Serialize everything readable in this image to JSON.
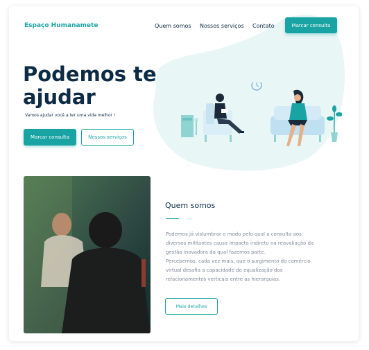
{
  "nav": {
    "brand": "Espaço Humanamete",
    "links": [
      "Quem somos",
      "Nossos serviços",
      "Contato"
    ],
    "cta": "Marcar consulta"
  },
  "hero": {
    "title": "Podemos te ajudar",
    "subtitle": "Vamos ajudar você a ter uma vida melhor !",
    "primary_button": "Marcar consulta",
    "secondary_button": "Nossos serviços"
  },
  "about": {
    "title": "Quem somos",
    "paragraphs": [
      "Podemos já vislumbrar o modo pelo qual a consulta aos diversos militantes causa impacto indireto na reavaliação da gestão inovadora da qual fazemos parte.",
      "Percebemos, cada vez mais, que o surgimento do comércio virtual desafia a capacidade de equalização dos relacionamentos verticais entre as hierarquias."
    ],
    "button": "Mais detalhes"
  },
  "colors": {
    "accent": "#1aa3a3",
    "navy": "#0d2b45",
    "blob": "#e9f6f6",
    "muted_text": "#7c8a99"
  },
  "icons": [
    "clock-icon",
    "plant-icon",
    "sofa-icon",
    "armchair-icon",
    "side-table-icon"
  ]
}
